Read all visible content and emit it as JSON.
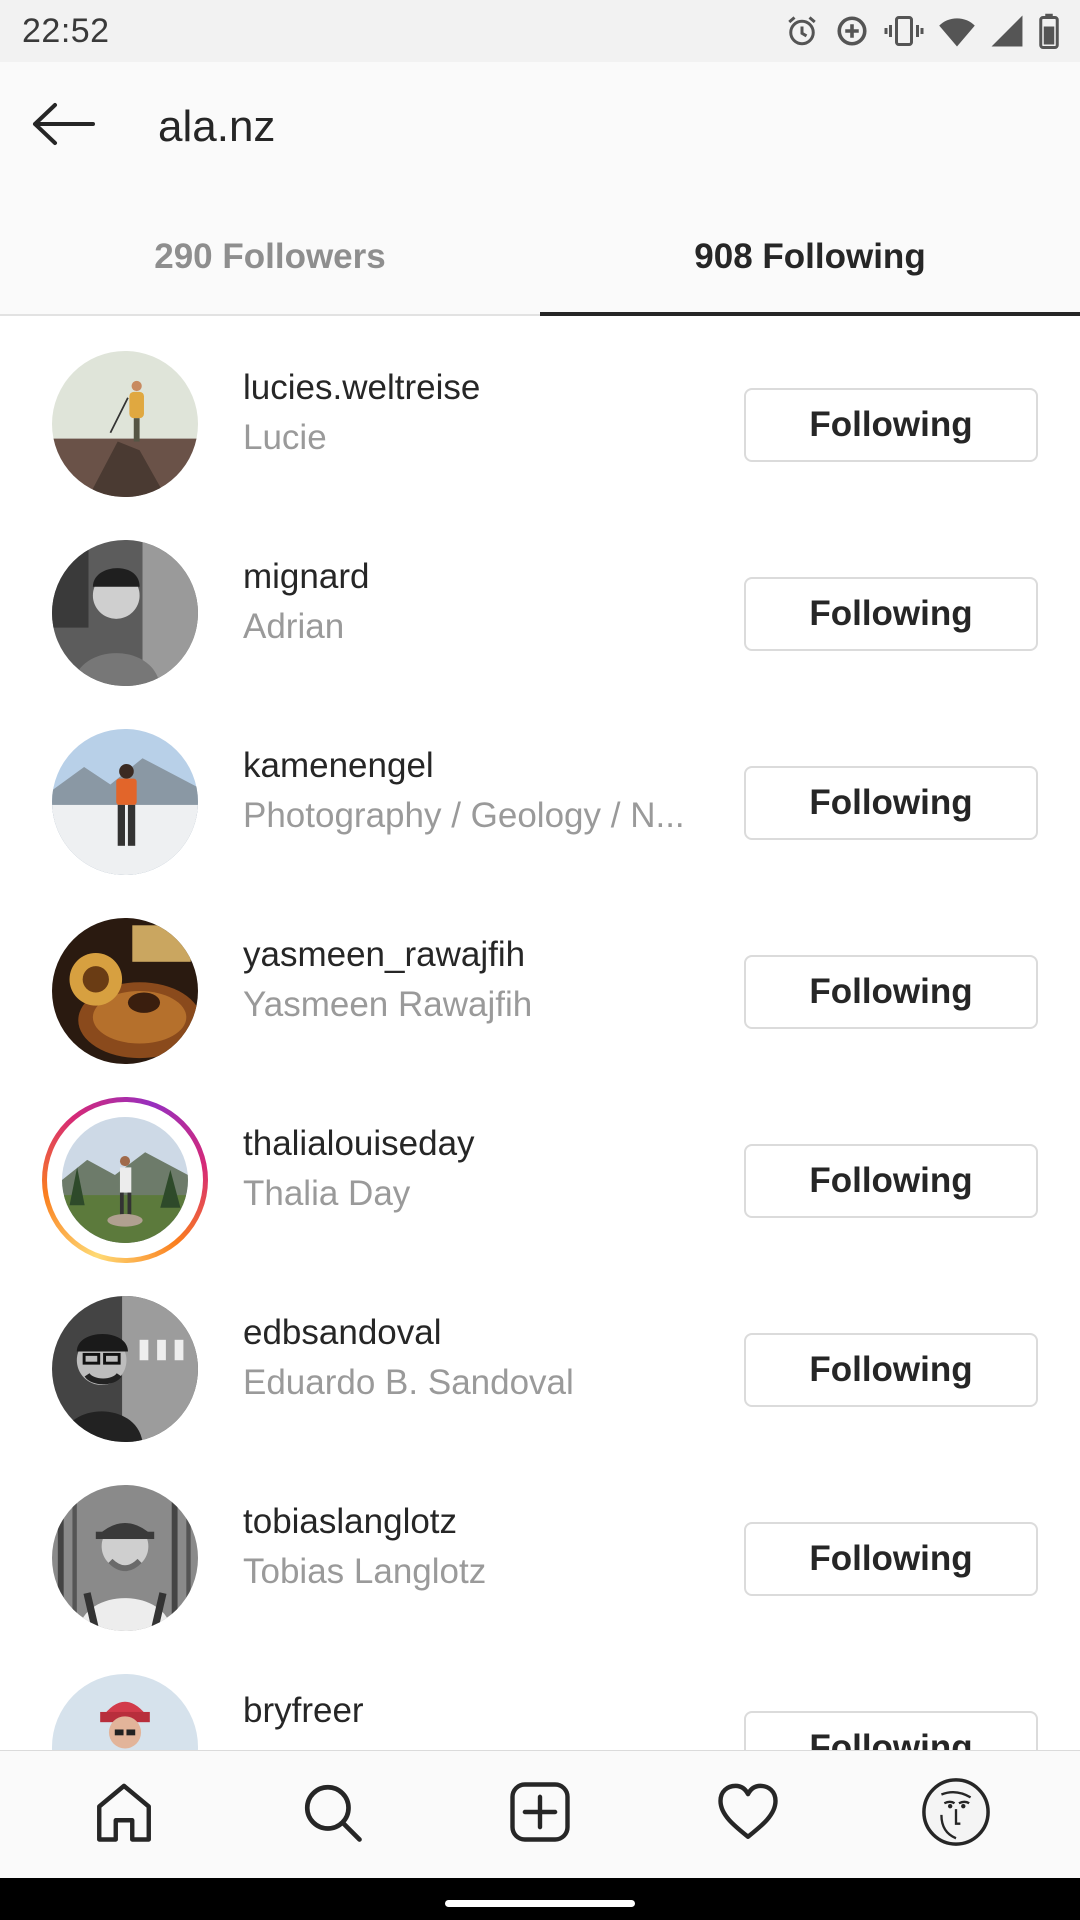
{
  "status_bar": {
    "time": "22:52",
    "icons": [
      "alarm-icon",
      "data-saver-icon",
      "vibrate-icon",
      "wifi-icon",
      "cellular-signal-icon",
      "battery-icon"
    ]
  },
  "header": {
    "back_icon": "arrow-left-icon",
    "title": "ala.nz"
  },
  "tabs": [
    {
      "label": "290 Followers",
      "active": false
    },
    {
      "label": "908 Following",
      "active": true
    }
  ],
  "users": [
    {
      "username": "lucies.weltreise",
      "name": "Lucie",
      "button": "Following",
      "story_ring": false
    },
    {
      "username": "mignard",
      "name": "Adrian",
      "button": "Following",
      "story_ring": false
    },
    {
      "username": "kamenengel",
      "name": "Photography / Geology / N...",
      "button": "Following",
      "story_ring": false
    },
    {
      "username": "yasmeen_rawajfih",
      "name": "Yasmeen Rawajfih",
      "button": "Following",
      "story_ring": false
    },
    {
      "username": "thalialouiseday",
      "name": "Thalia Day",
      "button": "Following",
      "story_ring": true
    },
    {
      "username": "edbsandoval",
      "name": "Eduardo B. Sandoval",
      "button": "Following",
      "story_ring": false
    },
    {
      "username": "tobiaslanglotz",
      "name": "Tobias Langlotz",
      "button": "Following",
      "story_ring": false
    },
    {
      "username": "bryfreer",
      "name": "",
      "button": "Following",
      "story_ring": false
    }
  ],
  "bottom_nav": {
    "items": [
      "home-icon",
      "search-icon",
      "new-post-icon",
      "activity-heart-icon",
      "profile-avatar-icon"
    ]
  },
  "colors": {
    "text_primary": "#262626",
    "text_secondary": "#9a9a9a",
    "button_border": "#dbdbdb",
    "story_ring": [
      "#feda75",
      "#fa7e1e",
      "#d62976",
      "#962fbf"
    ]
  }
}
